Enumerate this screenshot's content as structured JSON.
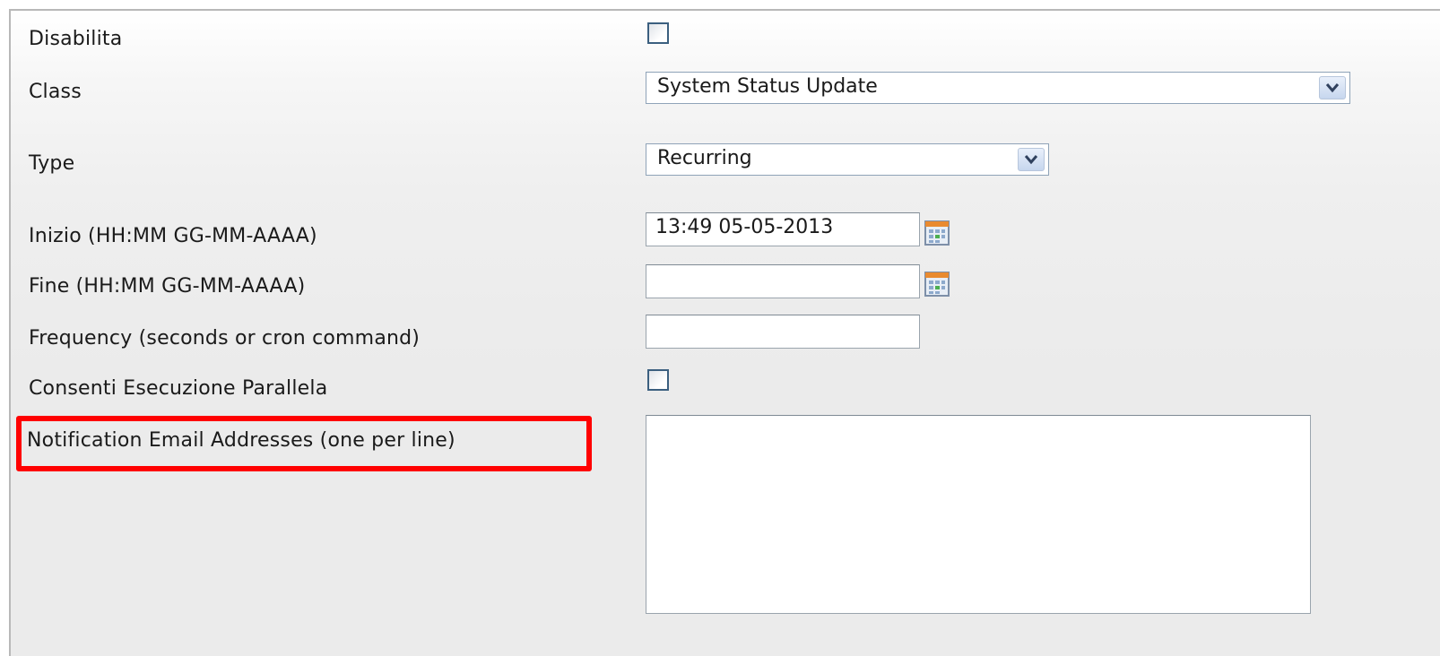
{
  "form": {
    "disabled": {
      "label": "Disabilita",
      "checked": false
    },
    "class": {
      "label": "Class",
      "value": "System Status Update"
    },
    "type": {
      "label": "Type",
      "value": "Recurring"
    },
    "start": {
      "label": "Inizio (HH:MM GG-MM-AAAA)",
      "value": "13:49 05-05-2013",
      "icon": "calendar-icon"
    },
    "end": {
      "label": "Fine (HH:MM GG-MM-AAAA)",
      "value": "",
      "icon": "calendar-icon"
    },
    "frequency": {
      "label": "Frequency (seconds or cron command)",
      "value": ""
    },
    "parallel": {
      "label": "Consenti Esecuzione Parallela",
      "checked": false
    },
    "emails": {
      "label": "Notification Email Addresses (one per line)",
      "value": ""
    }
  },
  "highlight": {
    "color": "#ff0000",
    "target": "emails-label"
  }
}
